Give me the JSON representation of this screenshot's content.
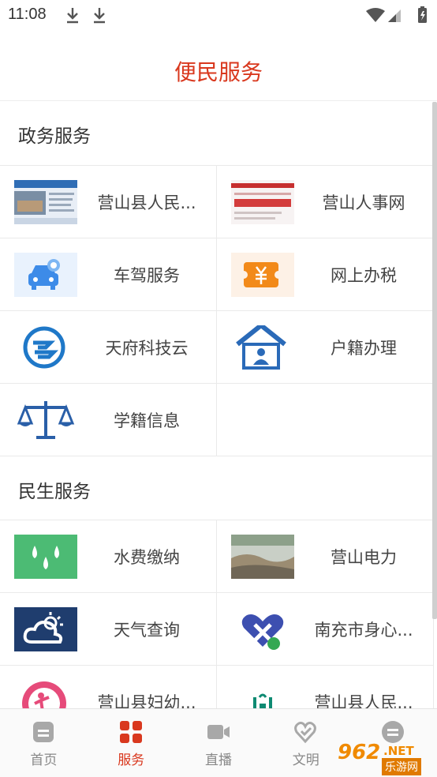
{
  "status_bar": {
    "time": "11:08"
  },
  "header": {
    "title": "便民服务"
  },
  "sections": [
    {
      "title": "政务服务",
      "items": [
        {
          "label": "营山县人民...",
          "icon": "gov-site-thumbnail"
        },
        {
          "label": "营山人事网",
          "icon": "hr-site-thumbnail"
        },
        {
          "label": "车驾服务",
          "icon": "car-icon"
        },
        {
          "label": "网上办税",
          "icon": "tax-ticket-icon"
        },
        {
          "label": "天府科技云",
          "icon": "tech-cloud-logo"
        },
        {
          "label": "户籍办理",
          "icon": "household-house-icon"
        },
        {
          "label": "学籍信息",
          "icon": "scale-icon"
        }
      ]
    },
    {
      "title": "民生服务",
      "items": [
        {
          "label": "水费缴纳",
          "icon": "water-drops-icon"
        },
        {
          "label": "营山电力",
          "icon": "power-company-thumbnail"
        },
        {
          "label": "天气查询",
          "icon": "weather-cloud-sun-icon"
        },
        {
          "label": "南充市身心...",
          "icon": "heart-logo"
        },
        {
          "label": "营山县妇幼...",
          "icon": "maternal-child-logo"
        },
        {
          "label": "营山县人民...",
          "icon": "hospital-logo"
        }
      ]
    }
  ],
  "bottom_nav": [
    {
      "label": "首页",
      "icon": "home-icon",
      "active": false
    },
    {
      "label": "服务",
      "icon": "grid-icon",
      "active": true
    },
    {
      "label": "直播",
      "icon": "video-camera-icon",
      "active": false
    },
    {
      "label": "文明",
      "icon": "heart-hand-icon",
      "active": false
    },
    {
      "label": "",
      "icon": "menu-icon",
      "active": false
    }
  ],
  "watermark": {
    "number": "962",
    "suffix": ".NET",
    "text": "乐游网"
  },
  "colors": {
    "accent": "#d9381e",
    "divider": "#eaeaea",
    "nav_inactive": "#888888",
    "water_green": "#4cbb74",
    "weather_navy": "#1f3d6e",
    "car_blue": "#3d8be8",
    "tax_orange": "#f28a1a"
  }
}
